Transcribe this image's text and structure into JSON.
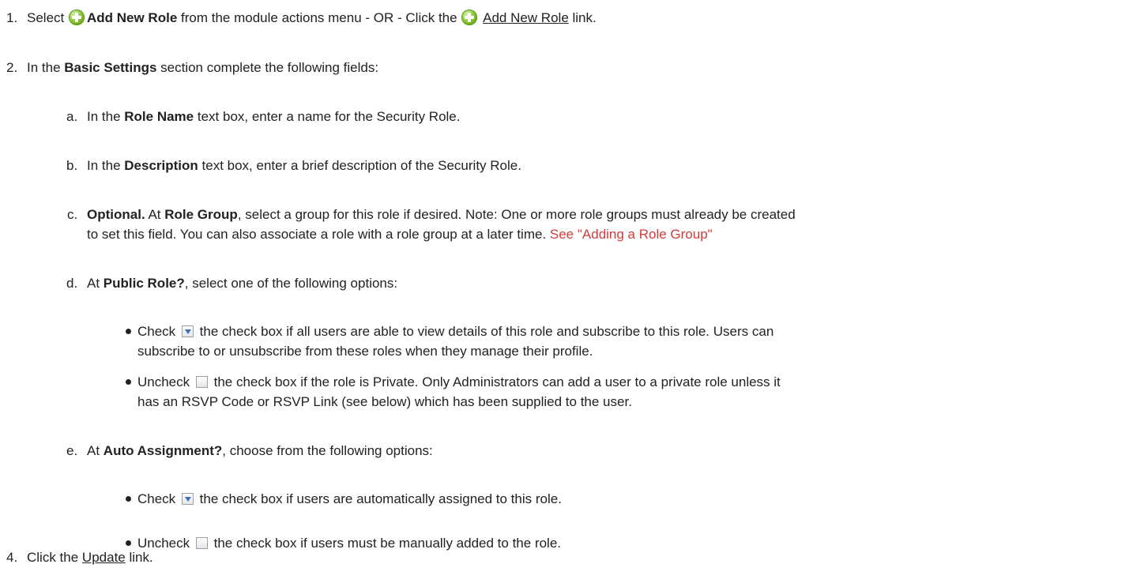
{
  "steps": {
    "s1": {
      "num": "1.",
      "t1": "Select ",
      "b1": "Add New Role",
      "t2": " from the module actions menu - OR - Click the ",
      "link": "Add New Role",
      "t3": " link."
    },
    "s2": {
      "num": "2.",
      "t1": "In the ",
      "b1": "Basic Settings",
      "t2": " section complete the following fields:"
    },
    "a": {
      "num": "a.",
      "t1": "In the ",
      "b1": "Role Name",
      "t2": " text box, enter a name for the Security Role."
    },
    "b": {
      "num": "b.",
      "t1": "In the ",
      "b1": "Description",
      "t2": " text box, enter a brief description of the Security Role."
    },
    "c": {
      "num": "c.",
      "b1": "Optional.",
      "t1": " At ",
      "b2": "Role Group",
      "t2": ", select a group for this role if desired. Note: One or more role groups must already be created",
      "l2a": "to set this field. You can also associate a role with a role group at a later time. ",
      "xref": "See \"Adding a Role Group\""
    },
    "d": {
      "num": "d.",
      "t1": "At ",
      "b1": "Public Role?",
      "t2": ", select one of the following options:",
      "opt1": {
        "t1": "Check ",
        "t2": " the check box if all users are able to view details of this role and subscribe to this role. Users can",
        "l2": "subscribe to or unsubscribe from these roles when they manage their profile."
      },
      "opt2": {
        "t1": "Uncheck ",
        "t2": " the check box if the role is Private. Only Administrators can add a user to a private role unless it",
        "l2": "has an RSVP Code or RSVP Link (see below) which has been supplied to the user."
      }
    },
    "e": {
      "num": "e.",
      "t1": "At ",
      "b1": "Auto Assignment?",
      "t2": ", choose from the following options:",
      "opt1": {
        "t1": "Check ",
        "t2": " the check box if users are automatically assigned to this role."
      },
      "opt2": {
        "t1": "Uncheck ",
        "t2": " the check box if users must be manually added to the role."
      }
    },
    "s4": {
      "num": "4.",
      "t1": "Click the ",
      "link": "Update",
      "t2": " link."
    }
  },
  "icons": {
    "add": "add-plus-icon",
    "checked": "checkbox-checked-icon",
    "unchecked": "checkbox-unchecked-icon"
  },
  "colors": {
    "text": "#222222",
    "xref": "#d13b3b",
    "add_icon": "#7fbf2a"
  }
}
